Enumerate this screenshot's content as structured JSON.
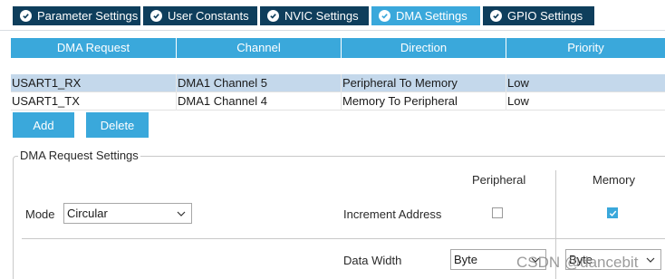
{
  "tabs": [
    {
      "label": "Parameter Settings",
      "active": false,
      "icon": "check-circle-icon"
    },
    {
      "label": "User Constants",
      "active": false,
      "icon": "check-circle-icon"
    },
    {
      "label": "NVIC Settings",
      "active": false,
      "icon": "check-circle-icon"
    },
    {
      "label": "DMA Settings",
      "active": true,
      "icon": "check-circle-icon"
    },
    {
      "label": "GPIO Settings",
      "active": false,
      "icon": "check-circle-icon"
    }
  ],
  "table": {
    "headers": [
      "DMA Request",
      "Channel",
      "Direction",
      "Priority"
    ],
    "rows": [
      {
        "request": "USART1_RX",
        "channel": "DMA1 Channel 5",
        "direction": "Peripheral To Memory",
        "priority": "Low",
        "selected": true
      },
      {
        "request": "USART1_TX",
        "channel": "DMA1 Channel 4",
        "direction": "Memory To Peripheral",
        "priority": "Low",
        "selected": false
      }
    ]
  },
  "buttons": {
    "add": "Add",
    "delete": "Delete"
  },
  "settings": {
    "group_title": "DMA Request Settings",
    "peripheral_heading": "Peripheral",
    "memory_heading": "Memory",
    "mode_label": "Mode",
    "mode_value": "Circular",
    "increment_label": "Increment Address",
    "peripheral_increment": false,
    "memory_increment": true,
    "data_width_label": "Data Width",
    "peripheral_width": "Byte",
    "memory_width": "Byte"
  },
  "watermark": "CSDN @dancebit",
  "colors": {
    "accent": "#3aa8db",
    "tab_dark": "#0e3e5c",
    "selected_row": "#c4d8eb"
  }
}
